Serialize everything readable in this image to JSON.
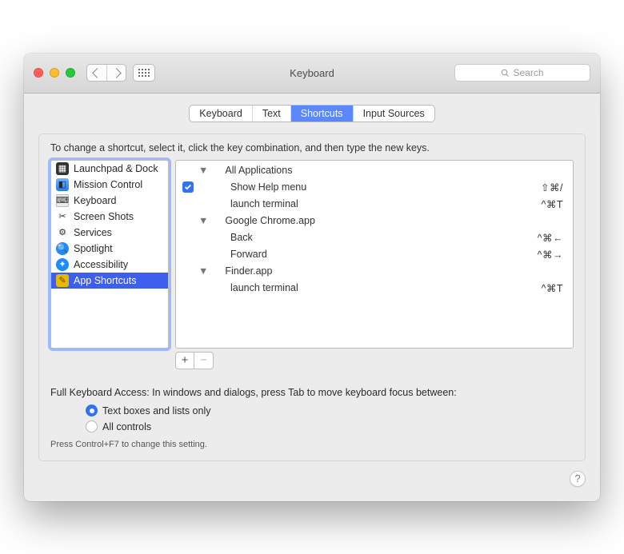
{
  "window": {
    "title": "Keyboard"
  },
  "toolbar": {
    "search_placeholder": "Search"
  },
  "tabs": [
    "Keyboard",
    "Text",
    "Shortcuts",
    "Input Sources"
  ],
  "tabs_selected_index": 2,
  "instruction": "To change a shortcut, select it, click the key combination, and then type the new keys.",
  "categories": [
    {
      "label": "Launchpad & Dock",
      "icon": "launchpad",
      "selected": false
    },
    {
      "label": "Mission Control",
      "icon": "mission",
      "selected": false
    },
    {
      "label": "Keyboard",
      "icon": "keyboard",
      "selected": false
    },
    {
      "label": "Screen Shots",
      "icon": "scissors",
      "selected": false
    },
    {
      "label": "Services",
      "icon": "gear",
      "selected": false
    },
    {
      "label": "Spotlight",
      "icon": "spotlight",
      "selected": false
    },
    {
      "label": "Accessibility",
      "icon": "accessibility",
      "selected": false
    },
    {
      "label": "App Shortcuts",
      "icon": "app",
      "selected": true
    }
  ],
  "shortcuts": {
    "groups": [
      {
        "name": "All Applications",
        "items": [
          {
            "label": "Show Help menu",
            "keys": "⇧⌘/",
            "checked": true
          },
          {
            "label": "launch terminal",
            "keys": "^⌘T",
            "checked": false
          }
        ]
      },
      {
        "name": "Google Chrome.app",
        "items": [
          {
            "label": "Back",
            "keys": "^⌘←",
            "checked": false
          },
          {
            "label": "Forward",
            "keys": "^⌘→",
            "checked": false
          }
        ]
      },
      {
        "name": "Finder.app",
        "items": [
          {
            "label": "launch terminal",
            "keys": "^⌘T",
            "checked": false
          }
        ]
      }
    ]
  },
  "addremove": {
    "add": "+",
    "remove": "−"
  },
  "fka": {
    "intro": "Full Keyboard Access: In windows and dialogs, press Tab to move keyboard focus between:",
    "options": [
      {
        "label": "Text boxes and lists only",
        "selected": true
      },
      {
        "label": "All controls",
        "selected": false
      }
    ],
    "hint": "Press Control+F7 to change this setting."
  },
  "help": "?"
}
